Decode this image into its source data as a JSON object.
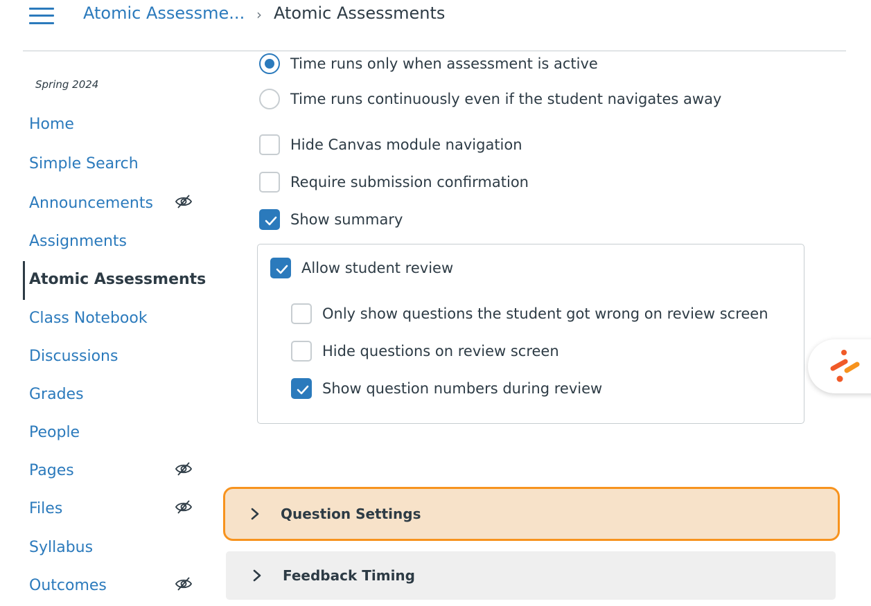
{
  "header": {
    "breadcrumb_link": "Atomic Assessme...",
    "separator": "›",
    "breadcrumb_current": "Atomic Assessments"
  },
  "sidebar": {
    "term": "Spring 2024",
    "items": [
      {
        "label": "Home",
        "hidden": false,
        "active": false
      },
      {
        "label": "Simple Search",
        "hidden": false,
        "active": false
      },
      {
        "label": "Announcements",
        "hidden": true,
        "active": false
      },
      {
        "label": "Assignments",
        "hidden": false,
        "active": false
      },
      {
        "label": "Atomic Assessments",
        "hidden": false,
        "active": true
      },
      {
        "label": "Class Notebook",
        "hidden": false,
        "active": false
      },
      {
        "label": "Discussions",
        "hidden": false,
        "active": false
      },
      {
        "label": "Grades",
        "hidden": false,
        "active": false
      },
      {
        "label": "People",
        "hidden": false,
        "active": false
      },
      {
        "label": "Pages",
        "hidden": true,
        "active": false
      },
      {
        "label": "Files",
        "hidden": true,
        "active": false
      },
      {
        "label": "Syllabus",
        "hidden": false,
        "active": false
      },
      {
        "label": "Outcomes",
        "hidden": true,
        "active": false
      }
    ]
  },
  "timer": {
    "option_active_only": {
      "label": "Time runs only when assessment is active",
      "selected": true
    },
    "option_continuous": {
      "label": "Time runs continuously even if the student navigates away",
      "selected": false
    }
  },
  "settings": {
    "hide_module_nav": {
      "label": "Hide Canvas module navigation",
      "checked": false
    },
    "require_confirmation": {
      "label": "Require submission confirmation",
      "checked": false
    },
    "show_summary": {
      "label": "Show summary",
      "checked": true
    }
  },
  "review": {
    "allow_review": {
      "label": "Allow student review",
      "checked": true
    },
    "only_wrong": {
      "label": "Only show questions the student got wrong on review screen",
      "checked": false
    },
    "hide_questions": {
      "label": "Hide questions on review screen",
      "checked": false
    },
    "show_numbers": {
      "label": "Show question numbers during review",
      "checked": true
    }
  },
  "accordions": {
    "question_settings": "Question Settings",
    "feedback_timing": "Feedback Timing"
  },
  "colors": {
    "link": "#2b7abc",
    "text": "#2d3b45",
    "highlight_border": "#f7931e",
    "highlight_fill": "#f7e2c9",
    "widget_accent": "#f05a28"
  },
  "icons": {
    "menu": "hamburger-icon",
    "hidden": "eye-slash-icon",
    "expand": "chevron-right-icon",
    "widget": "assistant-logo-icon"
  }
}
